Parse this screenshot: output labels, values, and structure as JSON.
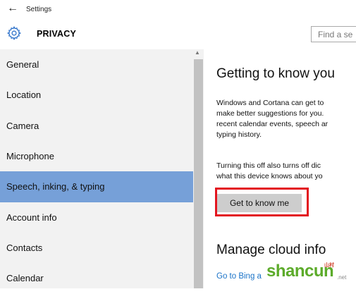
{
  "window": {
    "title": "Settings",
    "back_icon": "back-arrow-icon"
  },
  "header": {
    "title": "PRIVACY",
    "icon": "gear-icon",
    "search_placeholder": "Find a se"
  },
  "sidebar": {
    "items": [
      {
        "label": "General",
        "selected": false
      },
      {
        "label": "Location",
        "selected": false
      },
      {
        "label": "Camera",
        "selected": false
      },
      {
        "label": "Microphone",
        "selected": false
      },
      {
        "label": "Speech, inking, & typing",
        "selected": true
      },
      {
        "label": "Account info",
        "selected": false
      },
      {
        "label": "Contacts",
        "selected": false
      },
      {
        "label": "Calendar",
        "selected": false
      }
    ]
  },
  "content": {
    "heading": "Getting to know you",
    "para1": [
      "Windows and Cortana can get to",
      "make better suggestions for you.",
      "recent calendar events, speech ar",
      "typing history."
    ],
    "para2": [
      "Turning this off also turns off dic",
      "what this device knows about yo"
    ],
    "button_label": "Get to know me",
    "heading2": "Manage cloud info",
    "link": "Go to Bing a"
  },
  "watermark": {
    "text": "shancun",
    "small": "山村",
    "net": ".net"
  },
  "colors": {
    "selected_bg": "#76a0d8",
    "highlight_border": "#e3151f",
    "link": "#1a73c8",
    "sidebar_bg": "#f2f2f2"
  }
}
